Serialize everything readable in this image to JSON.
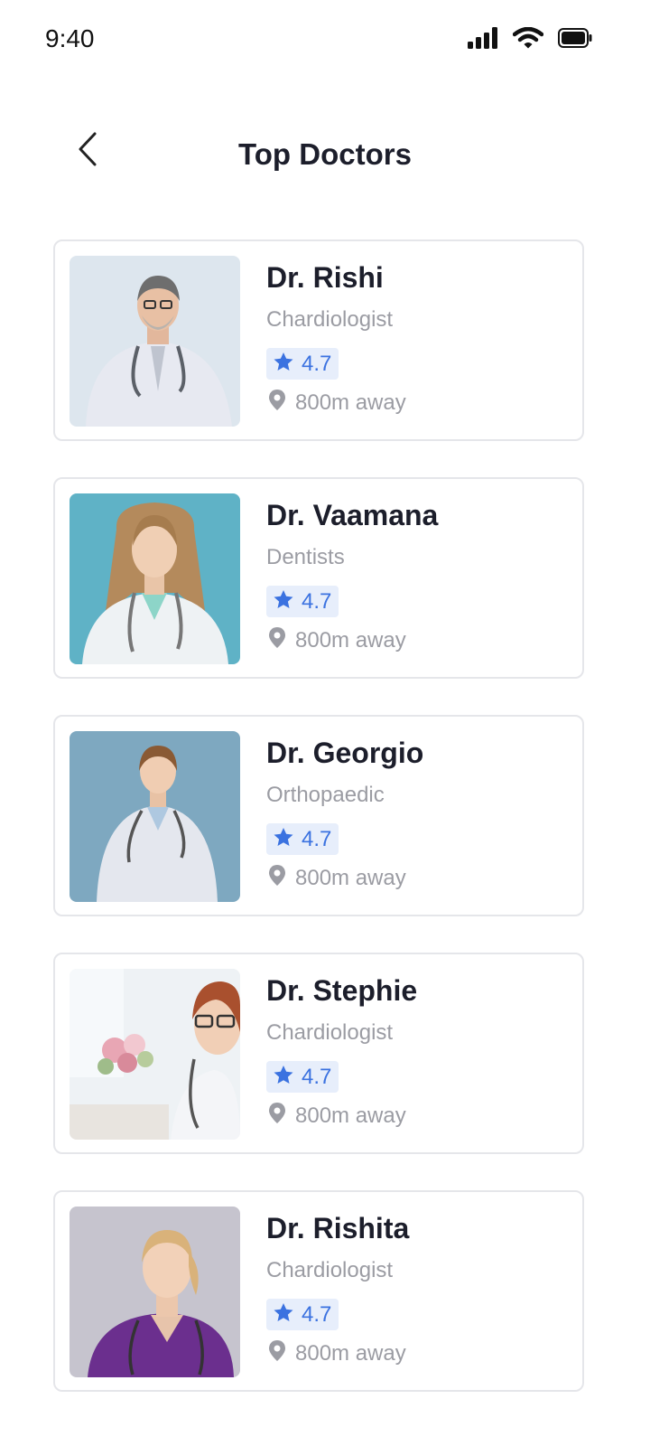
{
  "status_bar": {
    "time": "9:40"
  },
  "header": {
    "title": "Top Doctors"
  },
  "colors": {
    "accent": "#3b72e0",
    "badge_bg": "#e7eefb",
    "muted_text": "#9b9ca3",
    "card_border": "#e5e6ea"
  },
  "doctors": [
    {
      "name": "Dr. Rishi",
      "specialty": "Chardiologist",
      "rating": "4.7",
      "distance": "800m away"
    },
    {
      "name": "Dr. Vaamana",
      "specialty": "Dentists",
      "rating": "4.7",
      "distance": "800m away"
    },
    {
      "name": "Dr. Georgio",
      "specialty": "Orthopaedic",
      "rating": "4.7",
      "distance": "800m away"
    },
    {
      "name": "Dr. Stephie",
      "specialty": "Chardiologist",
      "rating": "4.7",
      "distance": "800m away"
    },
    {
      "name": "Dr. Rishita",
      "specialty": "Chardiologist",
      "rating": "4.7",
      "distance": "800m away"
    }
  ]
}
